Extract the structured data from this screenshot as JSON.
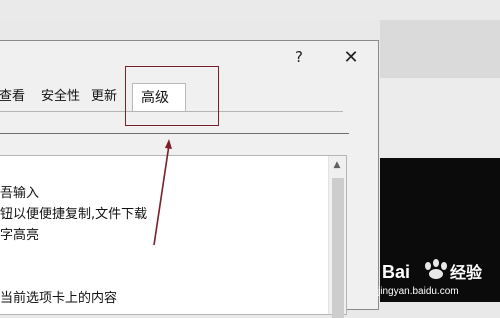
{
  "dialog": {
    "help_glyph": "?",
    "close_glyph": "✕"
  },
  "tabs": [
    {
      "label": "查看"
    },
    {
      "label": "安全性"
    },
    {
      "label": "更新"
    },
    {
      "label": "高级",
      "selected": true
    }
  ],
  "list_items": [
    "吾输入",
    "钮以便便捷复制,文件下载",
    "字高亮",
    "当前选项卡上的内容"
  ],
  "watermark": {
    "brand": "Baidu经验",
    "url": "jingyan.baidu.com"
  },
  "colors": {
    "annotation": "#7b1f2a",
    "dialog_bg": "#f0f0f0",
    "panel_bg": "#ffffff"
  }
}
